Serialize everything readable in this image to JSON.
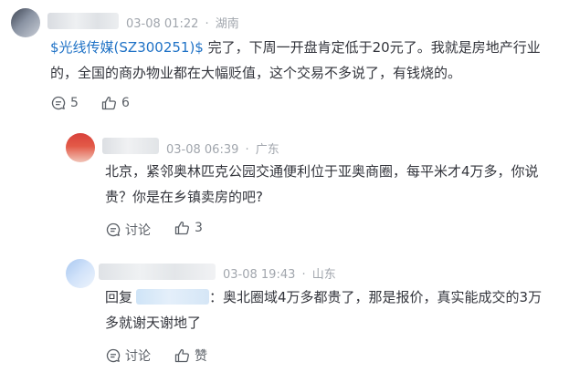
{
  "comments": [
    {
      "time": "03-08 01:22",
      "separator": "·",
      "location": "湖南",
      "stock_tag": "$光线传媒(SZ300251)$",
      "text_line1": " 完了，下周一开盘肯定低于20元了。我就是房地产行业",
      "text_line2": "的，全国的商办物业都在大幅贬值，这个交易不多说了，有钱烧的。",
      "reply_count": "5",
      "like_count": "6"
    },
    {
      "time": "03-08 06:39",
      "separator": "·",
      "location": "广东",
      "text_line1": "北京，紧邻奥林匹克公园交通便利位于亚奥商圈，每平米才4万多，你说",
      "text_line2": "贵？你是在乡镇卖房的吧?",
      "reply_label": "讨论",
      "like_count": "3"
    },
    {
      "time": "03-08 19:43",
      "separator": "·",
      "location": "山东",
      "reply_prefix": "回复",
      "text_line1": "：奥北圈域4万多都贵了，那是报价，真实能成交的3万",
      "text_line2": "多就谢天谢地了",
      "reply_label": "讨论",
      "like_label": "赞"
    }
  ],
  "colors": {
    "link": "#1f72c6",
    "meta": "#a1a6ad",
    "text": "#33353c",
    "icon": "#5a5f66"
  }
}
